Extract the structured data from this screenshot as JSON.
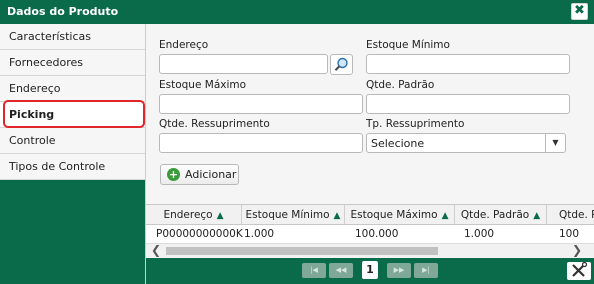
{
  "dialog": {
    "title": "Dados do Produto",
    "close_glyph": "✖"
  },
  "sidebar": {
    "items": [
      {
        "label": "Características"
      },
      {
        "label": "Fornecedores"
      },
      {
        "label": "Endereço"
      },
      {
        "label": "Picking"
      },
      {
        "label": "Controle"
      },
      {
        "label": "Tipos de Controle"
      }
    ],
    "active": "Picking"
  },
  "form": {
    "endereco_label": "Endereço",
    "endereco_value": "",
    "estoque_minimo_label": "Estoque Mínimo",
    "estoque_minimo_value": "",
    "estoque_maximo_label": "Estoque Máximo",
    "estoque_maximo_value": "",
    "qtde_padrao_label": "Qtde. Padrão",
    "qtde_padrao_value": "",
    "qtde_ressuprimento_label": "Qtde. Ressuprimento",
    "qtde_ressuprimento_value": "",
    "tp_ressuprimento_label": "Tp. Ressuprimento",
    "tp_ressuprimento_selected": "Selecione",
    "add_button_label": "Adicionar"
  },
  "grid": {
    "columns": [
      "Endereço",
      "Estoque Mínimo",
      "Estoque Máximo",
      "Qtde. Padrão",
      "Qtde. R"
    ],
    "rows": [
      [
        "P00000000000K",
        "1.000",
        "100.000",
        "1.000",
        "100"
      ]
    ]
  },
  "pager": {
    "current_page": "1"
  },
  "colors": {
    "brand_green": "#0a6b4b",
    "highlight_red": "#e0262b"
  },
  "icons": [
    "close-icon",
    "search-icon",
    "plus-icon",
    "sort-asc-icon",
    "first-page-icon",
    "prev-page-icon",
    "next-page-icon",
    "last-page-icon",
    "tools-icon"
  ]
}
